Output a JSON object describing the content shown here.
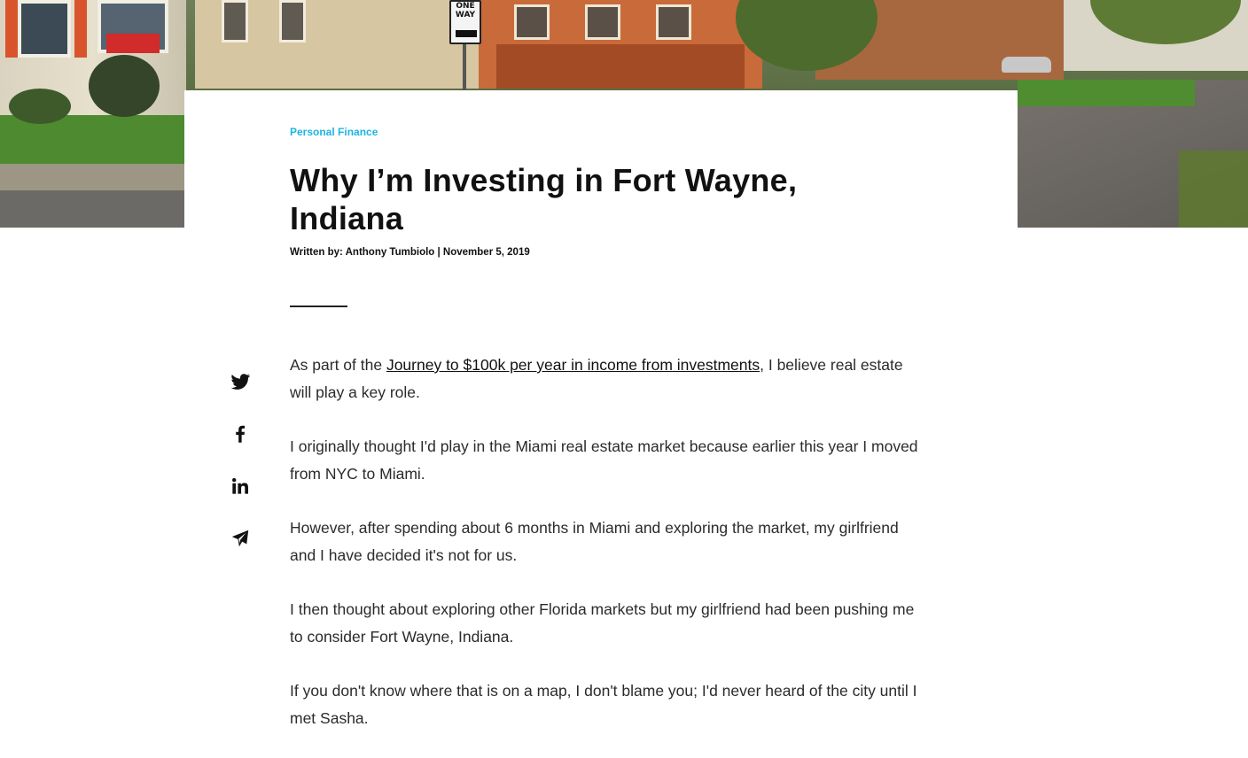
{
  "hero": {
    "sign_line1": "ONE",
    "sign_line2": "WAY"
  },
  "article": {
    "category": "Personal Finance",
    "title": "Why I’m Investing in Fort Wayne, Indiana",
    "byline": "Written by: Anthony Tumbiolo | November 5, 2019",
    "paragraphs": [
      {
        "before": "As part of the ",
        "link_text": "Journey to $100k per year in income from investments",
        "after": ", I believe real estate will play a key role."
      },
      {
        "text": "I originally thought I'd play in the Miami real estate market because earlier this year I moved from NYC to Miami."
      },
      {
        "text": "However, after spending about 6 months in Miami and exploring the market, my girlfriend and I have decided it's not for us."
      },
      {
        "text": "I then thought about exploring other Florida markets but my girlfriend had been pushing me to consider Fort Wayne, Indiana."
      },
      {
        "text": "If you don't know where that is on a map, I don't blame you; I'd never heard of the city until I met Sasha."
      }
    ]
  },
  "share": {
    "icons": [
      "twitter-icon",
      "facebook-icon",
      "linkedin-icon",
      "send-icon"
    ]
  },
  "colors": {
    "category": "#1fb4e3",
    "text": "#2b2b2b",
    "title": "#111111"
  }
}
